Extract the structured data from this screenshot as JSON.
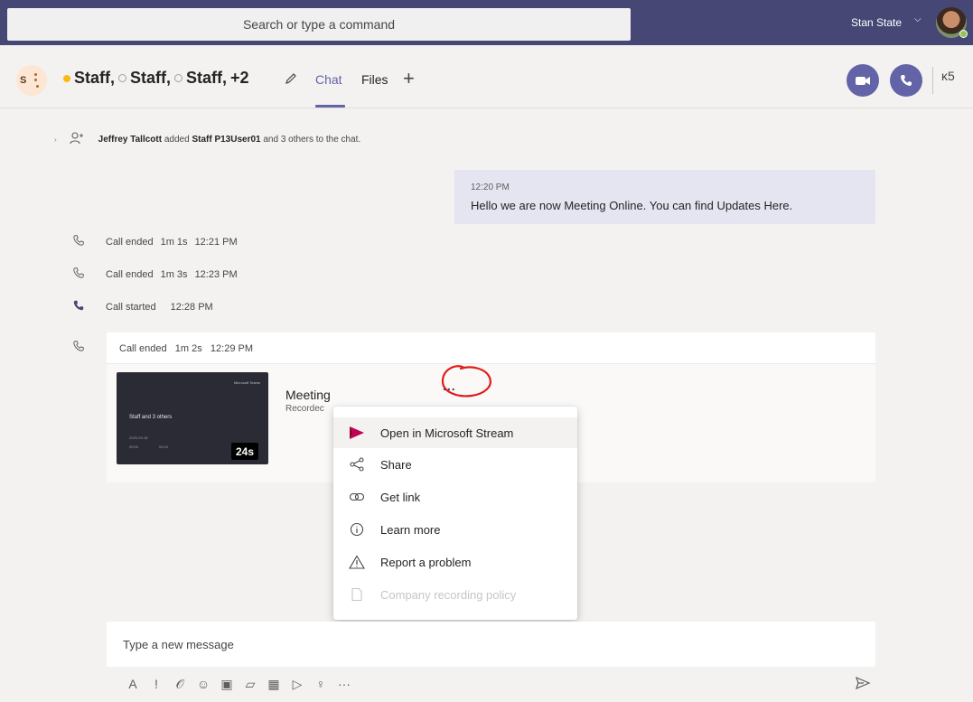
{
  "topbar": {
    "search_placeholder": "Search or type a command",
    "user_name": "Stan State",
    "user_chevron": "⌵"
  },
  "header": {
    "group_initial": "S",
    "participants": [
      "Staff,",
      "Staff,",
      "Staff,"
    ],
    "extra": "+2",
    "tabs": [
      {
        "label": "Chat",
        "active": true
      },
      {
        "label": "Files",
        "active": false
      }
    ],
    "add_tab": "+",
    "people_count": "ĸ5"
  },
  "messages": {
    "system": {
      "chevron": "›",
      "actor": "Jeffrey Tallcott",
      "verb": "added",
      "target": "Staff P13User01",
      "rest": "and 3 others to the chat."
    },
    "outgoing": {
      "time": "12:20 PM",
      "text": "Hello we are now Meeting Online. You can find Updates Here."
    },
    "calls": [
      {
        "status": "Call ended",
        "duration": "1m 1s",
        "time": "12:21 PM",
        "active": false
      },
      {
        "status": "Call ended",
        "duration": "1m 3s",
        "time": "12:23 PM",
        "active": false
      },
      {
        "status": "Call started",
        "duration": "",
        "time": "12:28 PM",
        "active": true
      }
    ],
    "call_card": {
      "status": "Call ended",
      "duration": "1m 2s",
      "time": "12:29 PM",
      "recording": {
        "title": "Meeting",
        "subtitle": "Recordec",
        "duration_badge": "24s",
        "thumb_title": "Staff and 3 others",
        "thumb_corner": "Microsoft Teams",
        "thumb_sub": "2020-03-18",
        "thumb_l1": "00:00",
        "thumb_l2": "00:24"
      },
      "more_label": "..."
    }
  },
  "context_menu": {
    "items": [
      {
        "label": "Open in Microsoft Stream",
        "icon": "stream-icon",
        "state": "hover"
      },
      {
        "label": "Share",
        "icon": "share-icon",
        "state": "normal"
      },
      {
        "label": "Get link",
        "icon": "link-icon",
        "state": "normal"
      },
      {
        "label": "Learn more",
        "icon": "info-icon",
        "state": "normal"
      },
      {
        "label": "Report a problem",
        "icon": "warning-icon",
        "state": "normal"
      },
      {
        "label": "Company recording policy",
        "icon": "document-icon",
        "state": "disabled"
      }
    ]
  },
  "compose": {
    "placeholder": "Type a new message",
    "toolbar": [
      {
        "icon": "format-icon",
        "glyph": "A"
      },
      {
        "icon": "important-icon",
        "glyph": "!"
      },
      {
        "icon": "attach-icon",
        "glyph": "𝒪"
      },
      {
        "icon": "emoji-icon",
        "glyph": "☺"
      },
      {
        "icon": "gif-icon",
        "glyph": "▣"
      },
      {
        "icon": "sticker-icon",
        "glyph": "▱"
      },
      {
        "icon": "schedule-meeting-icon",
        "glyph": "▦"
      },
      {
        "icon": "stream-share-icon",
        "glyph": "▷"
      },
      {
        "icon": "praise-icon",
        "glyph": "♀"
      },
      {
        "icon": "more-options-icon",
        "glyph": "···"
      }
    ]
  },
  "colors": {
    "brand": "#6264a7",
    "topbar": "#464775",
    "my_message": "#e5e5f1",
    "stream_red": "#c30052",
    "annotation_red": "#e11a1a"
  }
}
